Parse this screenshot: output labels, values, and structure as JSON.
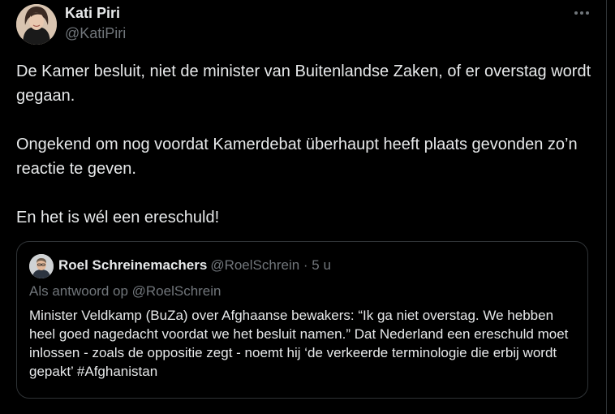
{
  "tweet": {
    "author_name": "Kati Piri",
    "author_handle": "@KatiPiri",
    "more_icon": "more-horizontal-icon",
    "paragraphs": [
      "De Kamer besluit, niet de minister van Buitenlandse Zaken, of er overstag wordt gegaan.",
      "Ongekend om nog voordat Kamerdebat überhaupt heeft plaats gevonden zo’n reactie te geven.",
      "En het is wél een ereschuld!"
    ]
  },
  "quote": {
    "author_name": "Roel Schreinemachers",
    "meta": "@RoelSchrein · 5 u",
    "reply_to": "Als antwoord op @RoelSchrein",
    "text": "Minister Veldkamp (BuZa) over Afghaanse bewakers: “Ik ga niet overstag. We hebben heel goed nagedacht voordat we het besluit namen.” Dat Nederland een ereschuld moet inlossen - zoals de oppositie zegt - noemt hij ‘de verkeerde terminologie die erbij wordt gepakt’ #Afghanistan"
  },
  "colors": {
    "background": "#000000",
    "text_primary": "#e7e9ea",
    "text_secondary": "#71767b",
    "border": "#2f3336"
  }
}
